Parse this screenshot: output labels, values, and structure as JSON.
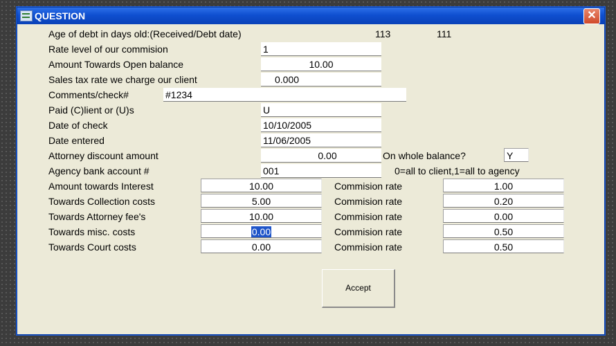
{
  "window": {
    "title": "QUESTION",
    "close_glyph": "✕"
  },
  "age_row": {
    "label": "Age of debt in days old:(Received/Debt date)",
    "received_days": "113",
    "debt_days": "111"
  },
  "fields": [
    {
      "label": "Rate level of our commision",
      "value": "1"
    },
    {
      "label": "Amount Towards Open balance",
      "value": "10.00"
    },
    {
      "label": "Sales tax rate we charge our client",
      "value": "0.000"
    },
    {
      "label": "Comments/check#",
      "value": "#1234"
    },
    {
      "label": "Paid (C)lient or (U)s",
      "value": "U"
    },
    {
      "label": "Date of check",
      "value": "10/10/2005"
    },
    {
      "label": "Date entered",
      "value": "11/06/2005"
    },
    {
      "label": "Attorney discount amount",
      "value": "0.00"
    },
    {
      "label": "Agency bank account #",
      "value": "001"
    }
  ],
  "whole_balance": {
    "label": "On whole balance?",
    "value": "Y"
  },
  "agency_note": "0=all to client,1=all to agency",
  "costs": [
    {
      "label": "Amount towards Interest",
      "amount": "10.00",
      "rate_label": "Commision rate",
      "rate": "1.00"
    },
    {
      "label": "Towards Collection costs",
      "amount": "5.00",
      "rate_label": "Commision rate",
      "rate": "0.20"
    },
    {
      "label": "Towards Attorney fee's",
      "amount": "10.00",
      "rate_label": "Commision rate",
      "rate": "0.00"
    },
    {
      "label": "Towards misc. costs",
      "amount": "0.00",
      "rate_label": "Commision rate",
      "rate": "0.50"
    },
    {
      "label": "Towards Court costs",
      "amount": "0.00",
      "rate_label": "Commision rate",
      "rate": "0.50"
    }
  ],
  "accept_button": {
    "mnemonic": "A",
    "rest": "ccept"
  },
  "colors": {
    "title_bar": "#0f4fd0",
    "window_bg": "#ecead8",
    "selection": "#1f55c9",
    "close_button": "#d04a2a"
  },
  "icons": {
    "app": "form-app-icon",
    "close": "close-icon"
  }
}
